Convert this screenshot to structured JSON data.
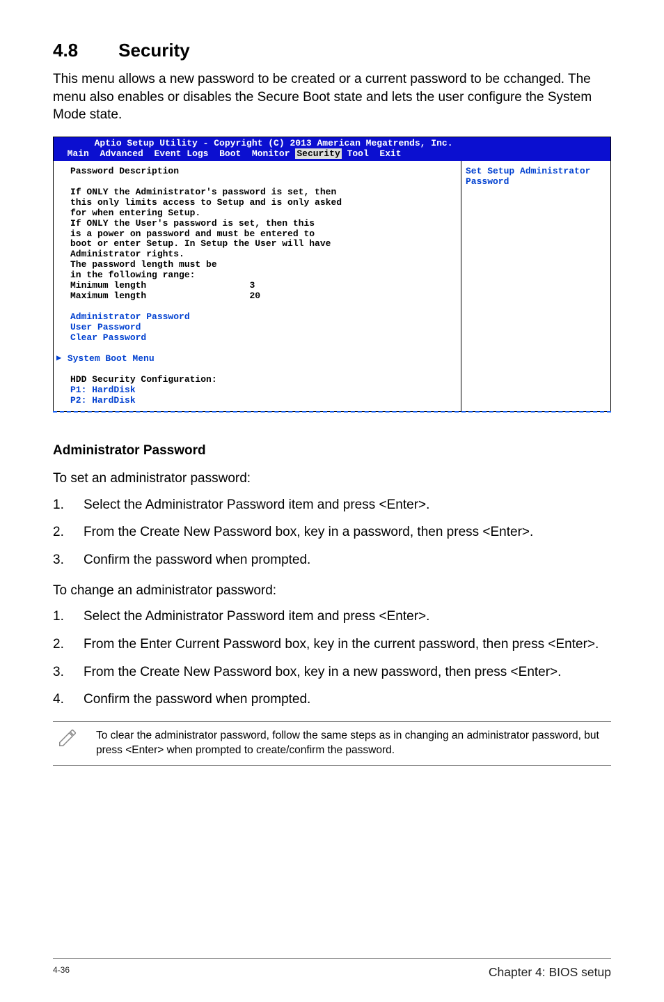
{
  "section": {
    "number": "4.8",
    "title": "Security"
  },
  "intro": "This menu allows a new password to be created or a current password to be cchanged. The menu also enables or disables the Secure Boot state and lets the user configure the System Mode state.",
  "bios": {
    "header_line1": "Aptio Setup Utility - Copyright (C) 2013 American Megatrends, Inc.",
    "menu": {
      "main": "Main",
      "advanced": "Advanced",
      "event_logs": "Event Logs",
      "boot": "Boot",
      "monitor": "Monitor",
      "security": "Security",
      "tool": "Tool",
      "exit": "Exit"
    },
    "left": {
      "pwd_desc_label": "Password Description",
      "l1": "If ONLY the Administrator's password is set, then",
      "l2": "this only limits access to Setup and is only asked",
      "l3": "for when entering Setup.",
      "l4": "If ONLY the User's password is set, then this",
      "l5": "is a power on password and must be entered to",
      "l6": "boot or enter Setup. In Setup the User will have",
      "l7": "Administrator rights.",
      "l8": "The password length must be",
      "l9": "in the following range:",
      "min_len_label": "Minimum length",
      "min_len_val": "3",
      "max_len_label": "Maximum length",
      "max_len_val": "20",
      "admin_pw": "Administrator Password",
      "user_pw": "User Password",
      "clear_pw": "Clear Password",
      "sys_boot": "System Boot Menu",
      "hdd_cfg": "HDD Security Configuration:",
      "p1": "P1: HardDisk",
      "p2": "P2: HardDisk"
    },
    "right": "Set Setup Administrator Password"
  },
  "subhead": "Administrator Password",
  "para_set": "To set an administrator password:",
  "steps_set": {
    "s1": "Select the Administrator Password item and press <Enter>.",
    "s2": "From the Create New Password box, key in a password, then press <Enter>.",
    "s3": "Confirm the password when prompted."
  },
  "para_change": "To change an administrator password:",
  "steps_change": {
    "s1": "Select the Administrator Password item and press <Enter>.",
    "s2": "From the Enter Current Password box, key in the current password, then press <Enter>.",
    "s3": "From the Create New Password box, key in a new password, then press <Enter>.",
    "s4": "Confirm the password when prompted."
  },
  "note": "To clear the administrator password, follow the same steps as in changing an administrator password, but press <Enter> when prompted to create/confirm the password.",
  "footer": {
    "page": "4-36",
    "chapter": "Chapter 4: BIOS setup"
  }
}
